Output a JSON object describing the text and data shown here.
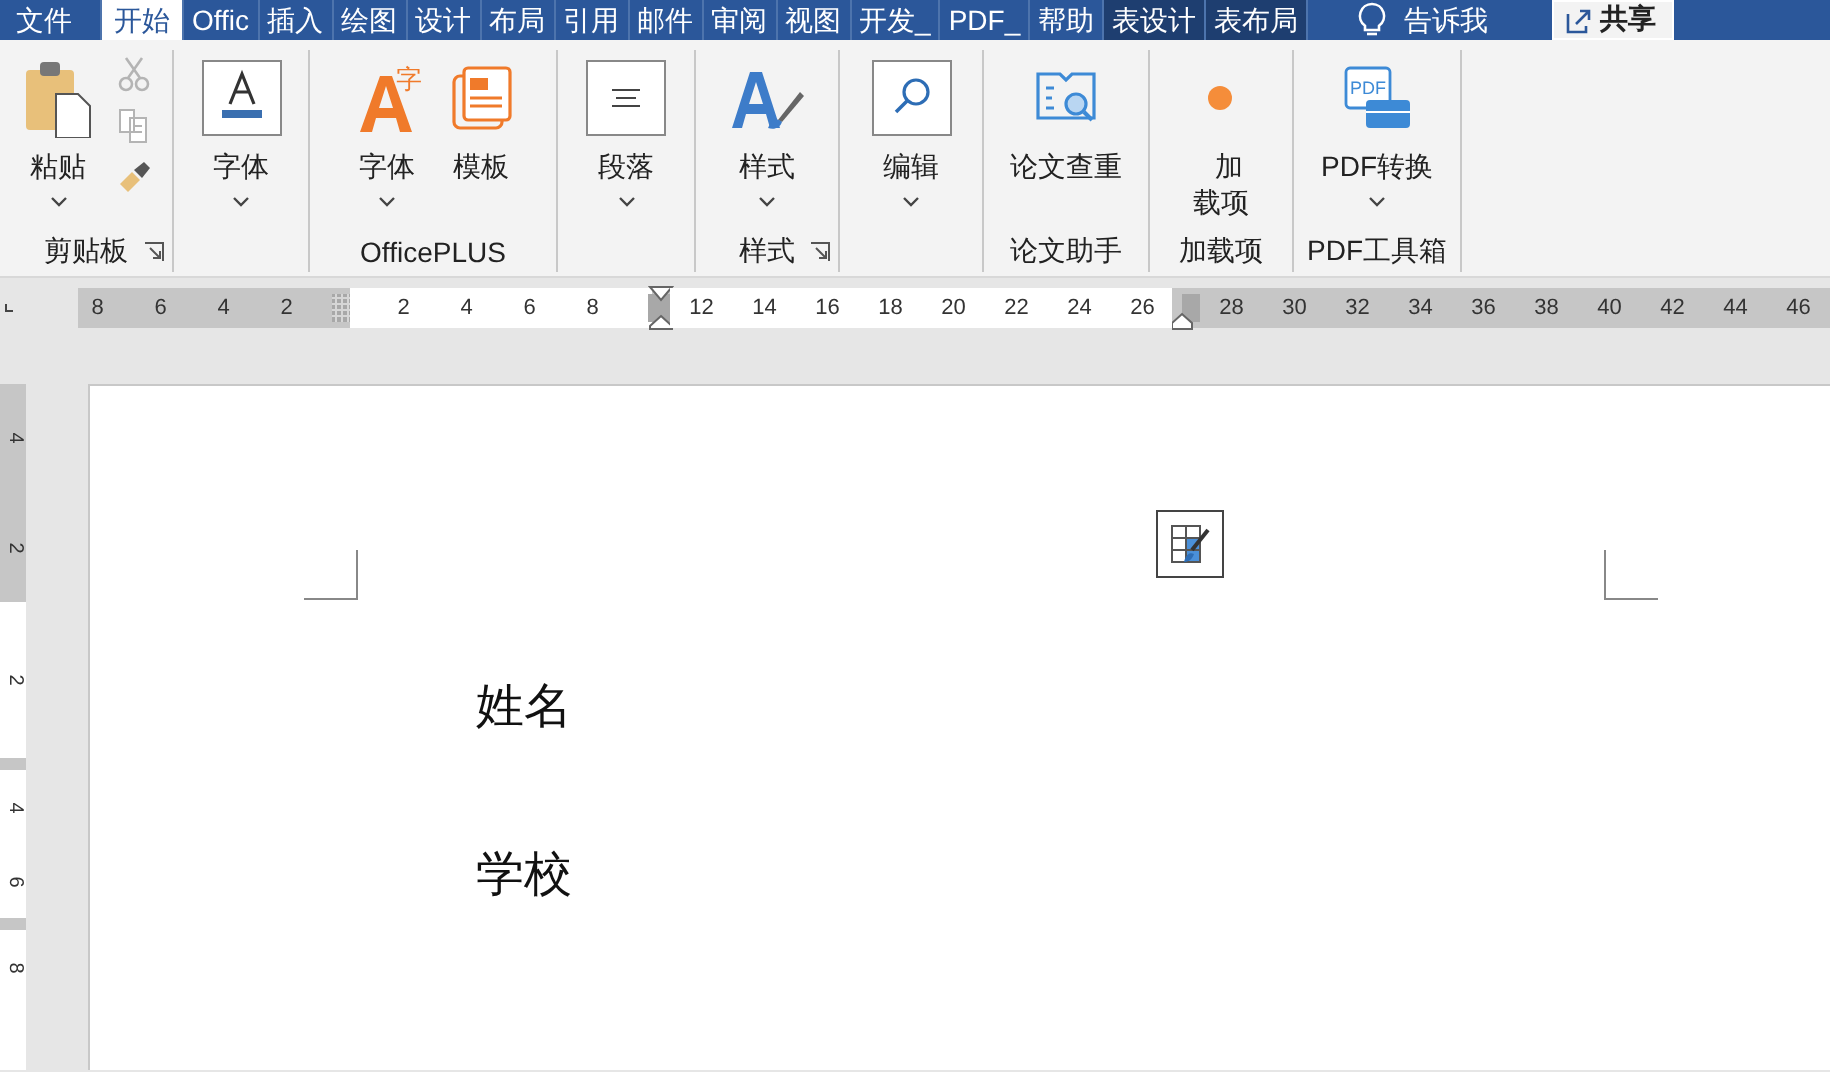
{
  "tabs": [
    {
      "label": "文件",
      "selected": false,
      "kind": "normal"
    },
    {
      "label": "开始",
      "selected": true,
      "kind": "normal"
    },
    {
      "label": "Offic",
      "selected": false,
      "kind": "normal"
    },
    {
      "label": "插入",
      "selected": false,
      "kind": "normal"
    },
    {
      "label": "绘图",
      "selected": false,
      "kind": "normal"
    },
    {
      "label": "设计",
      "selected": false,
      "kind": "normal"
    },
    {
      "label": "布局",
      "selected": false,
      "kind": "normal"
    },
    {
      "label": "引用",
      "selected": false,
      "kind": "normal"
    },
    {
      "label": "邮件",
      "selected": false,
      "kind": "normal"
    },
    {
      "label": "审阅",
      "selected": false,
      "kind": "normal"
    },
    {
      "label": "视图",
      "selected": false,
      "kind": "normal"
    },
    {
      "label": "开发_",
      "selected": false,
      "kind": "normal"
    },
    {
      "label": "PDF_",
      "selected": false,
      "kind": "normal"
    },
    {
      "label": "帮助",
      "selected": false,
      "kind": "normal"
    },
    {
      "label": "表设计",
      "selected": false,
      "kind": "contextual"
    },
    {
      "label": "表布局",
      "selected": false,
      "kind": "contextual"
    }
  ],
  "tell_me": "告诉我",
  "share_button": "共享",
  "ribbon_groups": [
    {
      "label": "剪贴板",
      "launcher": true,
      "buttons": [
        {
          "label": "粘贴",
          "dropdown": true
        }
      ],
      "small_buttons": [
        {
          "disabled": true
        },
        {
          "disabled": true
        },
        {
          "disabled": false
        }
      ]
    },
    {
      "buttons": [
        {
          "label": "字体",
          "dropdown": true
        }
      ]
    },
    {
      "label": "OfficePLUS",
      "launcher": false,
      "buttons": [
        {
          "label": "字体",
          "dropdown": true,
          "icon_text": "字"
        },
        {
          "label": "模板",
          "dropdown": false
        }
      ]
    },
    {
      "buttons": [
        {
          "label": "段落",
          "dropdown": true
        }
      ]
    },
    {
      "label": "样式",
      "launcher": true,
      "buttons": [
        {
          "label": "样式",
          "dropdown": true
        }
      ]
    },
    {
      "buttons": [
        {
          "label": "编辑",
          "dropdown": true
        }
      ]
    },
    {
      "label": "论文助手",
      "launcher": false,
      "buttons": [
        {
          "label": "论文查重",
          "dropdown": false
        }
      ]
    },
    {
      "label": "加载项",
      "launcher": false,
      "buttons": [
        {
          "label": "加载项",
          "dropdown": false
        }
      ]
    },
    {
      "label": "PDF工具箱",
      "launcher": false,
      "buttons": [
        {
          "label": "PDF转换",
          "dropdown": true,
          "icon_text": "PDF"
        }
      ]
    }
  ],
  "horizontal_ruler": [
    {
      "kind": "margin",
      "labels": [
        "8",
        "6",
        "4",
        "2"
      ]
    },
    {
      "kind": "text",
      "labels": [
        "2",
        "4",
        "6",
        "8"
      ]
    },
    {
      "kind": "text",
      "labels": [
        "12",
        "14",
        "16",
        "18",
        "20",
        "22",
        "24",
        "26"
      ]
    },
    {
      "kind": "margin",
      "labels": [
        "28",
        "30",
        "32",
        "34",
        "36",
        "38",
        "40",
        "42",
        "44",
        "46"
      ]
    }
  ],
  "vertical_ruler": [
    {
      "kind": "margin",
      "labels": [
        "4",
        "2"
      ]
    },
    {
      "kind": "text",
      "labels": [
        "2"
      ]
    },
    {
      "kind": "gap"
    },
    {
      "kind": "text",
      "labels": [
        "4",
        "6"
      ]
    },
    {
      "kind": "gap"
    },
    {
      "kind": "text",
      "labels": [
        "8"
      ]
    }
  ],
  "document": {
    "paragraphs": [
      "姓名",
      "学校"
    ]
  }
}
